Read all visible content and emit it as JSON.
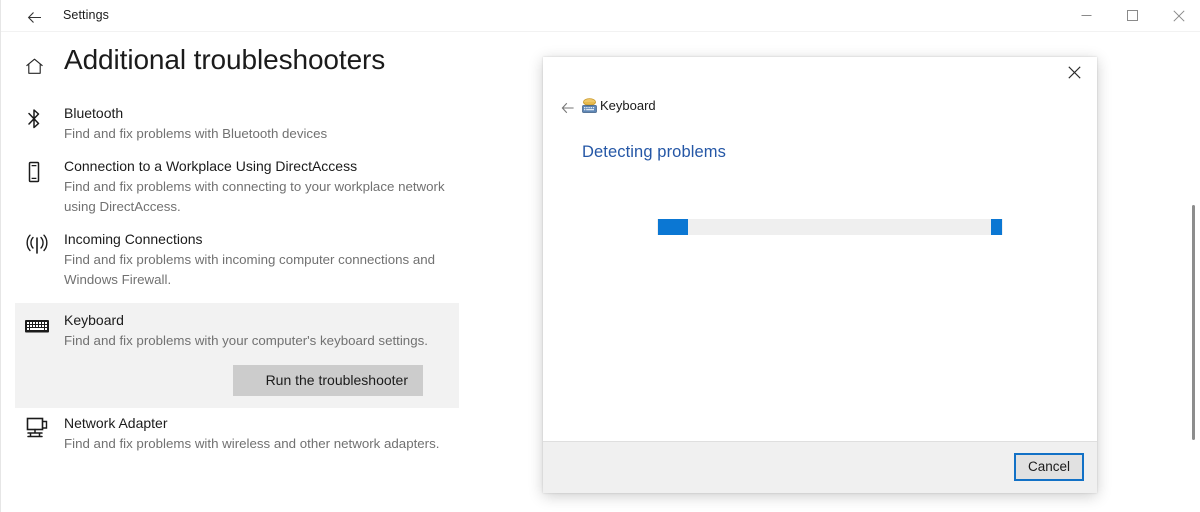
{
  "titlebar": {
    "title": "Settings",
    "back_icon": "back-arrow-icon",
    "minimize_label": "–",
    "maximize_label": "□",
    "close_label": "×"
  },
  "page": {
    "home_icon": "home-icon",
    "title": "Additional troubleshooters"
  },
  "troubleshooters": [
    {
      "icon": "bluetooth-icon",
      "title": "Bluetooth",
      "desc": "Find and fix problems with Bluetooth devices",
      "selected": false
    },
    {
      "icon": "workplace-device-icon",
      "title": "Connection to a Workplace Using DirectAccess",
      "desc": "Find and fix problems with connecting to your workplace network using DirectAccess.",
      "selected": false
    },
    {
      "icon": "incoming-connections-icon",
      "title": "Incoming Connections",
      "desc": "Find and fix problems with incoming computer connections and Windows Firewall.",
      "selected": false
    },
    {
      "icon": "keyboard-icon",
      "title": "Keyboard",
      "desc": "Find and fix problems with your computer's keyboard settings.",
      "selected": true,
      "action_label": "Run the troubleshooter"
    },
    {
      "icon": "network-adapter-icon",
      "title": "Network Adapter",
      "desc": "Find and fix problems with wireless and other network adapters.",
      "selected": false
    }
  ],
  "dialog": {
    "close_label": "×",
    "back_icon": "back-arrow-icon",
    "breadcrumb_icon": "keyboard-troubleshooter-icon",
    "breadcrumb_label": "Keyboard",
    "heading": "Detecting problems",
    "progress": {
      "style": "indeterminate",
      "accent_color": "#0b77d3",
      "track_color": "#efefef"
    },
    "cancel_label": "Cancel"
  },
  "colors": {
    "accent": "#0b77d3",
    "heading_link": "#2557a6",
    "selected_row": "#f2f2f2",
    "button_face": "#cccccc",
    "footer": "#f0f0f0",
    "focus_border": "#1271c6"
  }
}
